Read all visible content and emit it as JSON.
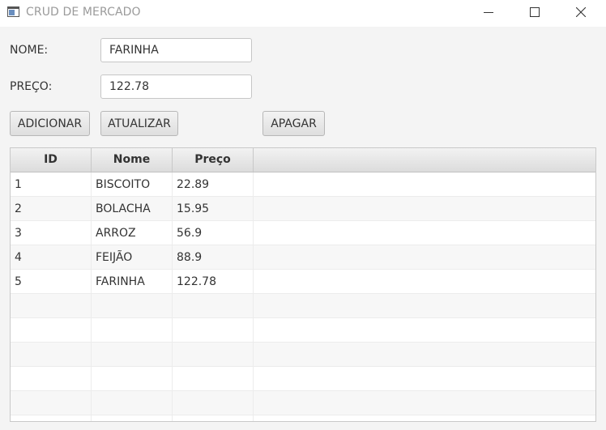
{
  "window": {
    "title": "CRUD DE MERCADO",
    "icons": {
      "app": "app-window-icon",
      "minimize": "minimize-icon",
      "maximize": "maximize-icon",
      "close": "close-icon"
    }
  },
  "form": {
    "nome_label": "NOME:",
    "nome_value": "FARINHA",
    "preco_label": "PREÇO:",
    "preco_value": "122.78"
  },
  "buttons": {
    "adicionar": "ADICIONAR",
    "atualizar": "ATUALIZAR",
    "apagar": "APAGAR"
  },
  "table": {
    "columns": [
      "ID",
      "Nome",
      "Preço"
    ],
    "rows": [
      [
        "1",
        "BISCOITO",
        "22.89"
      ],
      [
        "2",
        "BOLACHA",
        "15.95"
      ],
      [
        "3",
        "ARROZ",
        "56.9"
      ],
      [
        "4",
        "FEIJÃO",
        "88.9"
      ],
      [
        "5",
        "FARINHA",
        "122.78"
      ]
    ]
  }
}
